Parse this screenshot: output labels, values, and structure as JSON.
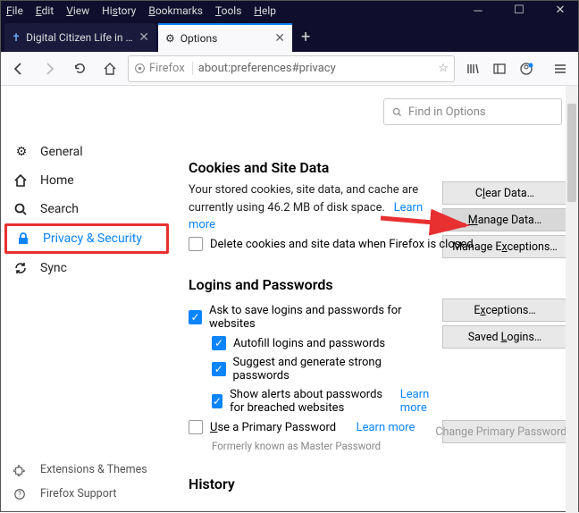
{
  "menubar": [
    "File",
    "Edit",
    "View",
    "History",
    "Bookmarks",
    "Tools",
    "Help"
  ],
  "tabs": [
    {
      "title": "Digital Citizen Life in a digital w",
      "active": false
    },
    {
      "title": "Options",
      "active": true
    }
  ],
  "url": {
    "prefix": "Firefox",
    "value": "about:preferences#privacy"
  },
  "findPlaceholder": "Find in Options",
  "sidebar": {
    "items": [
      {
        "label": "General"
      },
      {
        "label": "Home"
      },
      {
        "label": "Search"
      },
      {
        "label": "Privacy & Security"
      },
      {
        "label": "Sync"
      }
    ],
    "bottom": [
      {
        "label": "Extensions & Themes"
      },
      {
        "label": "Firefox Support"
      }
    ]
  },
  "cookies": {
    "heading": "Cookies and Site Data",
    "desc1": "Your stored cookies, site data, and cache are currently using 46.2 MB of disk space.",
    "learn": "Learn more",
    "checkbox": "Delete cookies and site data when Firefox is closed",
    "buttons": {
      "clear": "Clear Data…",
      "manage": "Manage Data…",
      "exceptions": "Manage Exceptions…"
    }
  },
  "logins": {
    "heading": "Logins and Passwords",
    "askSave": "Ask to save logins and passwords for websites",
    "autofill": "Autofill logins and passwords",
    "suggest": "Suggest and generate strong passwords",
    "alerts": "Show alerts about passwords for breached websites",
    "learn": "Learn more",
    "primary": "Use a Primary Password",
    "note": "Formerly known as Master Password",
    "buttons": {
      "exceptions": "Exceptions…",
      "saved": "Saved Logins…",
      "change": "Change Primary Password…"
    }
  },
  "history": {
    "heading": "History"
  }
}
